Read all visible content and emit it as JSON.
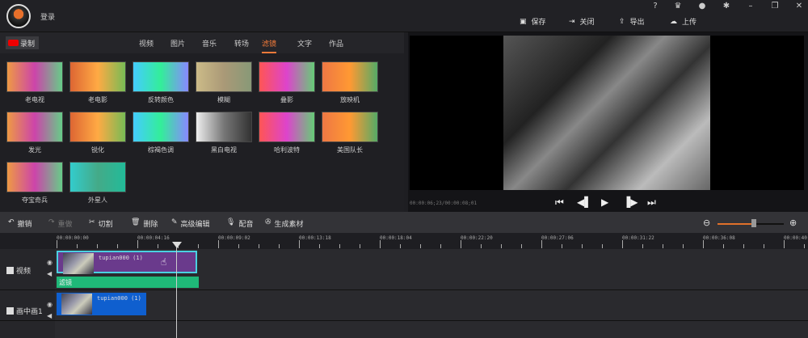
{
  "header": {
    "login": "登录",
    "window_buttons": [
      "?",
      "vip-crown",
      "notification",
      "settings",
      "minimize",
      "restore",
      "close"
    ],
    "actions": [
      {
        "icon": "save-icon",
        "label": "保存"
      },
      {
        "icon": "exit-icon",
        "label": "关闭"
      },
      {
        "icon": "export-icon",
        "label": "导出"
      },
      {
        "icon": "upload-icon",
        "label": "上传"
      }
    ]
  },
  "tabs": {
    "record": "录制",
    "items": [
      "视频",
      "图片",
      "音乐",
      "转场",
      "滤镜",
      "文字",
      "作品"
    ],
    "active": "滤镜"
  },
  "filters": [
    "老电视",
    "老电影",
    "反转颜色",
    "模糊",
    "叠影",
    "放映机",
    "发光",
    "锐化",
    "棕褐色调",
    "黑白电视",
    "哈利波特",
    "美国队长",
    "夺宝奇兵",
    "外星人"
  ],
  "preview": {
    "time": "00:00:06;23/00:00:08;01"
  },
  "toolbar": {
    "items": [
      {
        "icon": "undo-icon",
        "label": "撤销"
      },
      {
        "icon": "redo-icon",
        "label": "重做",
        "disabled": true
      },
      {
        "icon": "scissors-icon",
        "label": "切割"
      },
      {
        "icon": "trash-icon",
        "label": "删除"
      },
      {
        "icon": "pencil-icon",
        "label": "高级编辑"
      },
      {
        "icon": "microphone-icon",
        "label": "配音"
      },
      {
        "icon": "film-reel-icon",
        "label": "生成素材"
      }
    ],
    "zoom_level": 0.55,
    "accent": "#e0702a"
  },
  "ruler": [
    "00:00:00:00",
    "00:00:04:16",
    "00:00:09:02",
    "00:00:13:18",
    "00:00:18:04",
    "00:00:22:20",
    "00:00:27:06",
    "00:00:31:22",
    "00:00:36:08",
    "00:00:40;"
  ],
  "tracks": [
    {
      "name": "视频",
      "clip": "tupian000 (1)",
      "filter": "滤镜"
    },
    {
      "name": "画中画1",
      "clip": "tupian000 (1)"
    }
  ]
}
